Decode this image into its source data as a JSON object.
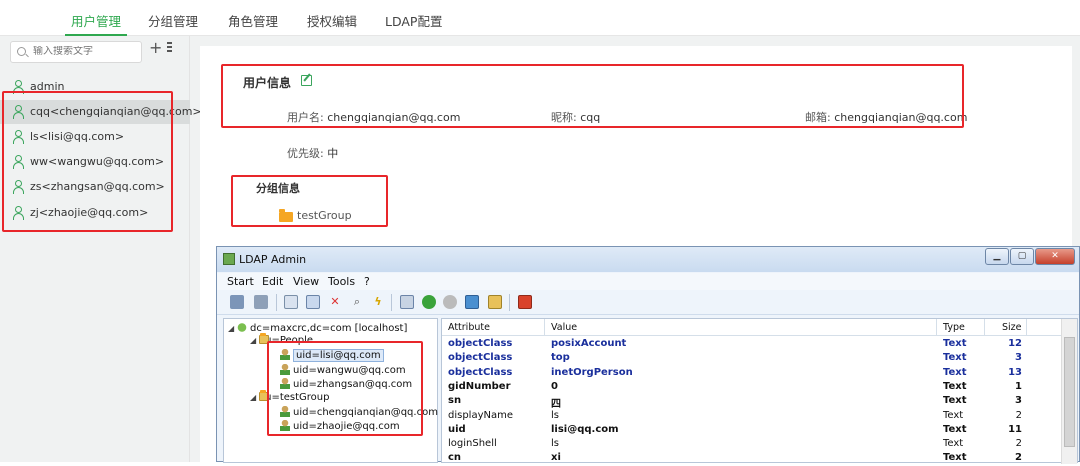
{
  "topnav": {
    "tabs": [
      {
        "label": "用户管理",
        "active": true
      },
      {
        "label": "分组管理",
        "active": false
      },
      {
        "label": "角色管理",
        "active": false
      },
      {
        "label": "授权编辑",
        "active": false
      },
      {
        "label": "LDAP配置",
        "active": false
      }
    ]
  },
  "sidebar": {
    "search_placeholder": "输入搜索文字",
    "add_label": "+",
    "users": [
      {
        "label": "admin",
        "selected": false
      },
      {
        "label": "cqq<chengqianqian@qq.com>",
        "selected": true
      },
      {
        "label": "ls<lisi@qq.com>",
        "selected": false
      },
      {
        "label": "ww<wangwu@qq.com>",
        "selected": false
      },
      {
        "label": "zs<zhangsan@qq.com>",
        "selected": false
      },
      {
        "label": "zj<zhaojie@qq.com>",
        "selected": false
      }
    ]
  },
  "userinfo": {
    "title": "用户信息",
    "username_label": "用户名:",
    "username": "chengqianqian@qq.com",
    "nickname_label": "昵称:",
    "nickname": "cqq",
    "email_label": "邮箱:",
    "email": "chengqianqian@qq.com",
    "priority_label": "优先级:",
    "priority": "中"
  },
  "groupinfo": {
    "title": "分组信息",
    "group": "testGroup"
  },
  "ldap": {
    "window_title": "LDAP Admin",
    "menu": [
      "Start",
      "Edit",
      "View",
      "Tools",
      "?"
    ],
    "tree": {
      "root": "dc=maxcrc,dc=com [localhost]",
      "people": "ou=People",
      "people_children": [
        "uid=lisi@qq.com",
        "uid=wangwu@qq.com",
        "uid=zhangsan@qq.com"
      ],
      "group": "ou=testGroup",
      "group_children": [
        "uid=chengqianqian@qq.com",
        "uid=zhaojie@qq.com"
      ]
    },
    "grid": {
      "headers": [
        "Attribute",
        "Value",
        "Type",
        "Size"
      ],
      "rows": [
        {
          "attr": "objectClass",
          "value": "posixAccount",
          "type": "Text",
          "size": "12",
          "style": "blue"
        },
        {
          "attr": "objectClass",
          "value": "top",
          "type": "Text",
          "size": "3",
          "style": "blue"
        },
        {
          "attr": "objectClass",
          "value": "inetOrgPerson",
          "type": "Text",
          "size": "13",
          "style": "blue"
        },
        {
          "attr": "gidNumber",
          "value": "0",
          "type": "Text",
          "size": "1",
          "style": "bold"
        },
        {
          "attr": "sn",
          "value": "四",
          "type": "Text",
          "size": "3",
          "style": "bold"
        },
        {
          "attr": "displayName",
          "value": "ls",
          "type": "Text",
          "size": "2",
          "style": "normal"
        },
        {
          "attr": "uid",
          "value": "lisi@qq.com",
          "type": "Text",
          "size": "11",
          "style": "bold"
        },
        {
          "attr": "loginShell",
          "value": "ls",
          "type": "Text",
          "size": "2",
          "style": "normal"
        },
        {
          "attr": "cn",
          "value": "xi",
          "type": "Text",
          "size": "2",
          "style": "bold"
        }
      ]
    }
  },
  "colors": {
    "accent": "#2fa84f",
    "highlight": "#e8262a",
    "ldap_blue": "#1a2f9c"
  }
}
